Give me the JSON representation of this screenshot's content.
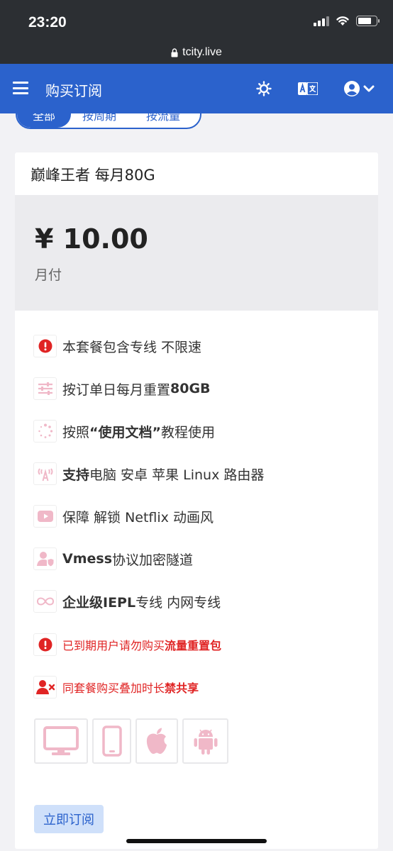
{
  "status_bar": {
    "time": "23:20"
  },
  "url_bar": {
    "url": "tcity.live"
  },
  "navbar": {
    "title": "购买订阅"
  },
  "filters": {
    "tabs": [
      "全部",
      "按周期",
      "按流量"
    ]
  },
  "plan": {
    "name": "巅峰王者 每月80G",
    "price": "¥ 10.00",
    "period": "月付",
    "features": [
      {
        "pre": "本套餐包含专线 不限速",
        "bold": "",
        "post": ""
      },
      {
        "pre": "按订单日每月重置 ",
        "bold": "80GB",
        "post": ""
      },
      {
        "pre": "按照 ",
        "bold": "“使用文档”",
        "post": " 教程使用"
      },
      {
        "pre": "",
        "bold": "支持",
        "post": " 电脑 安卓 苹果 Linux 路由器"
      },
      {
        "pre": "保障 解锁 Netflix 动画风",
        "bold": "",
        "post": ""
      },
      {
        "pre": "",
        "bold": "Vmess",
        "post": " 协议加密隧道"
      },
      {
        "pre": "",
        "bold": "企业级IEPL",
        "post": " 专线 内网专线"
      }
    ],
    "warnings": [
      {
        "pre": "已到期用户请勿购买 ",
        "bold": "流量重置包"
      },
      {
        "pre": "同套餐购买叠加时长 ",
        "bold": "禁共享"
      }
    ],
    "devices": [
      "desktop-icon",
      "phone-icon",
      "apple-icon",
      "android-icon"
    ],
    "subscribe_label": "立即订阅"
  },
  "colors": {
    "primary": "#2b62cc",
    "warning": "#e02424",
    "icon_pink": "#f0b8c8"
  }
}
